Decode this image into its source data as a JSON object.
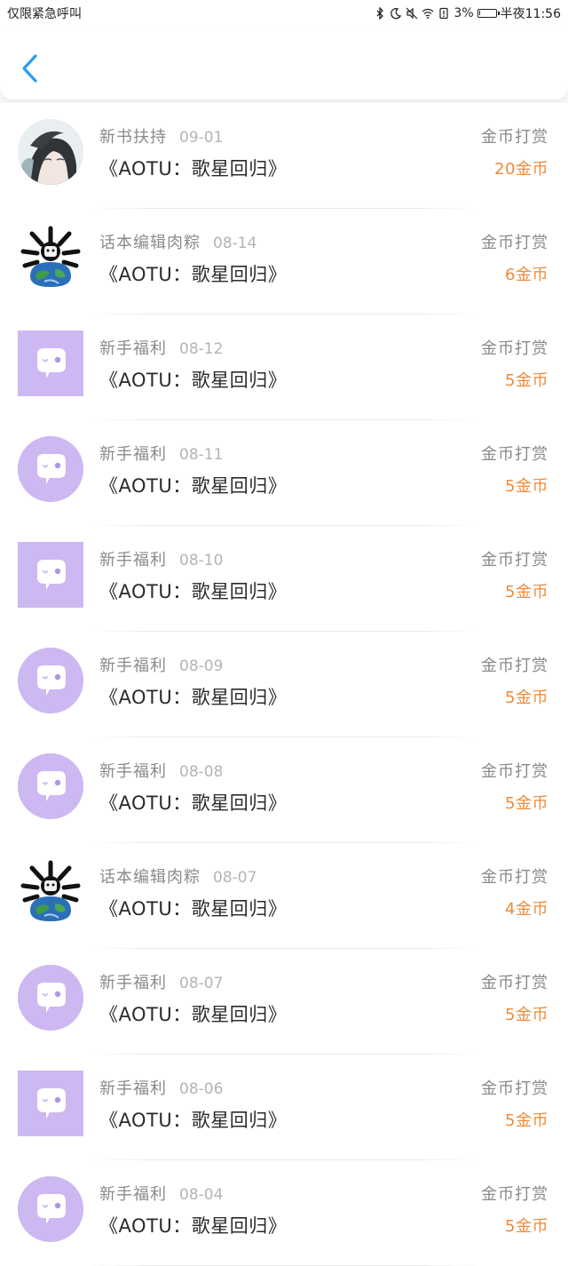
{
  "status_bar": {
    "carrier": "仅限紧急呼叫",
    "battery": "3%",
    "battery_level": 0.03,
    "time": "半夜11:56"
  },
  "nav": {
    "back_icon": "chevron-left-icon",
    "accent_color": "#2a9df4"
  },
  "colors": {
    "amount": "#ef8a38",
    "bubble_avatar": "#cdb8f2"
  },
  "records": [
    {
      "avatar": "anime",
      "shape": "circle",
      "name": "新书扶持",
      "date": "09-01",
      "book": "《AOTU：歌星回归》",
      "kind": "金币打赏",
      "amount": "20金币"
    },
    {
      "avatar": "earth",
      "shape": "square",
      "name": "话本编辑肉粽",
      "date": "08-14",
      "book": "《AOTU：歌星回归》",
      "kind": "金币打赏",
      "amount": "6金币"
    },
    {
      "avatar": "bubble",
      "shape": "square",
      "name": "新手福利",
      "date": "08-12",
      "book": "《AOTU：歌星回归》",
      "kind": "金币打赏",
      "amount": "5金币"
    },
    {
      "avatar": "bubble",
      "shape": "circle",
      "name": "新手福利",
      "date": "08-11",
      "book": "《AOTU：歌星回归》",
      "kind": "金币打赏",
      "amount": "5金币"
    },
    {
      "avatar": "bubble",
      "shape": "square",
      "name": "新手福利",
      "date": "08-10",
      "book": "《AOTU：歌星回归》",
      "kind": "金币打赏",
      "amount": "5金币"
    },
    {
      "avatar": "bubble",
      "shape": "circle",
      "name": "新手福利",
      "date": "08-09",
      "book": "《AOTU：歌星回归》",
      "kind": "金币打赏",
      "amount": "5金币"
    },
    {
      "avatar": "bubble",
      "shape": "circle",
      "name": "新手福利",
      "date": "08-08",
      "book": "《AOTU：歌星回归》",
      "kind": "金币打赏",
      "amount": "5金币"
    },
    {
      "avatar": "earth",
      "shape": "square",
      "name": "话本编辑肉粽",
      "date": "08-07",
      "book": "《AOTU：歌星回归》",
      "kind": "金币打赏",
      "amount": "4金币"
    },
    {
      "avatar": "bubble",
      "shape": "circle",
      "name": "新手福利",
      "date": "08-07",
      "book": "《AOTU：歌星回归》",
      "kind": "金币打赏",
      "amount": "5金币"
    },
    {
      "avatar": "bubble",
      "shape": "square",
      "name": "新手福利",
      "date": "08-06",
      "book": "《AOTU：歌星回归》",
      "kind": "金币打赏",
      "amount": "5金币"
    },
    {
      "avatar": "bubble",
      "shape": "circle",
      "name": "新手福利",
      "date": "08-04",
      "book": "《AOTU：歌星回归》",
      "kind": "金币打赏",
      "amount": "5金币"
    }
  ]
}
